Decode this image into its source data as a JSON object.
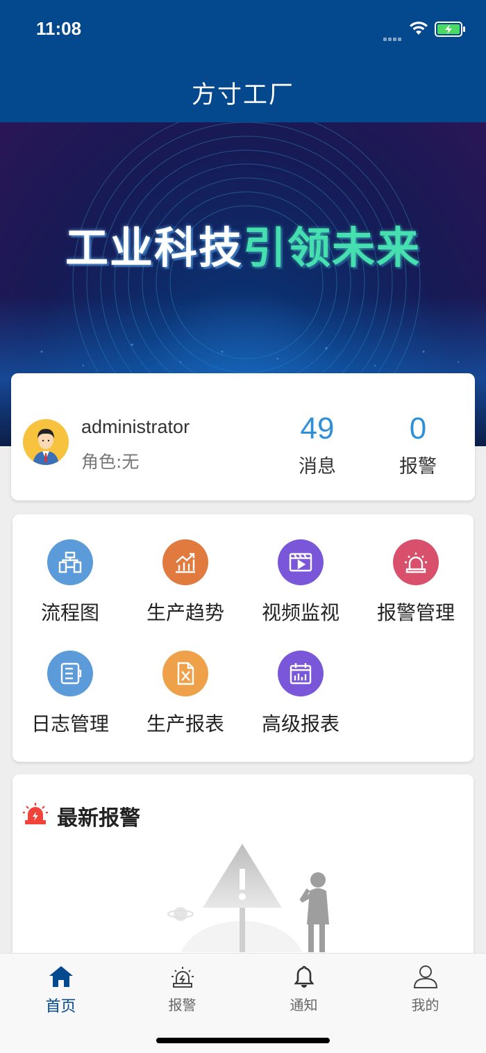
{
  "status": {
    "time": "11:08"
  },
  "header": {
    "title": "方寸工厂"
  },
  "banner": {
    "text_part1": "工业科技",
    "text_part2": "引领未来"
  },
  "user": {
    "name": "administrator",
    "role": "角色:无",
    "messages": {
      "count": "49",
      "label": "消息"
    },
    "alarms": {
      "count": "0",
      "label": "报警"
    }
  },
  "menu": [
    {
      "label": "流程图",
      "icon": "flowchart-icon",
      "color": "#5b9bd9"
    },
    {
      "label": "生产趋势",
      "icon": "trend-chart-icon",
      "color": "#e07a3f"
    },
    {
      "label": "视频监视",
      "icon": "video-icon",
      "color": "#7a56d8"
    },
    {
      "label": "报警管理",
      "icon": "alarm-light-icon",
      "color": "#d9506c"
    },
    {
      "label": "日志管理",
      "icon": "log-icon",
      "color": "#5b9bd9"
    },
    {
      "label": "生产报表",
      "icon": "excel-report-icon",
      "color": "#eea149"
    },
    {
      "label": "高级报表",
      "icon": "calendar-report-icon",
      "color": "#7a56d8"
    }
  ],
  "alarms_section": {
    "title": "最新报警"
  },
  "tabs": [
    {
      "label": "首页",
      "icon": "home-icon",
      "active": true
    },
    {
      "label": "报警",
      "icon": "alarm-icon",
      "active": false
    },
    {
      "label": "通知",
      "icon": "bell-icon",
      "active": false
    },
    {
      "label": "我的",
      "icon": "user-icon",
      "active": false
    }
  ],
  "colors": {
    "primary": "#04488d",
    "stat": "#2f8fd8",
    "background": "#eeeeee"
  }
}
